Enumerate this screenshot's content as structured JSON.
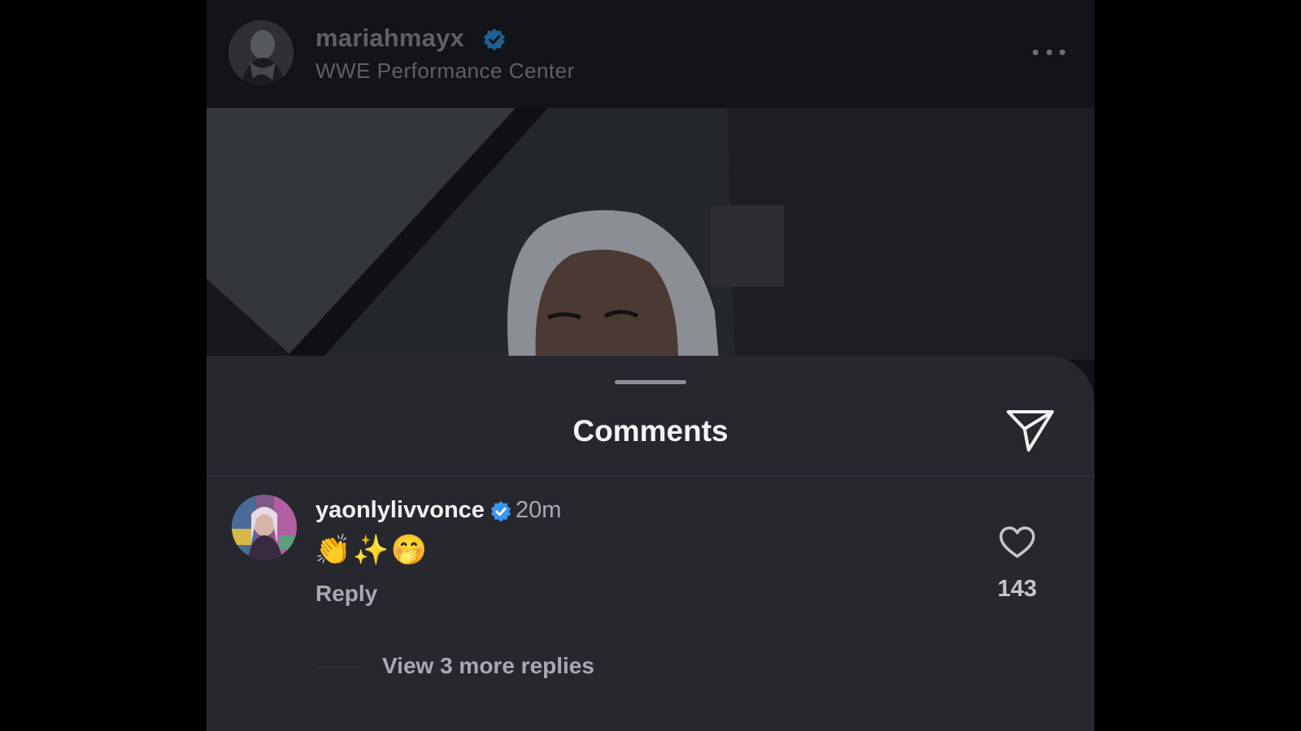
{
  "post": {
    "username": "mariahmayx",
    "location": "WWE Performance Center",
    "verified_icon": "verified-badge-icon",
    "more_icon": "more-horizontal-icon"
  },
  "comments_sheet": {
    "title": "Comments",
    "share_icon": "send-paper-plane-icon",
    "comment": {
      "username": "yaonlylivvonce",
      "time": "20m",
      "text": "👏✨🤭",
      "reply_label": "Reply",
      "like_count": "143",
      "like_icon": "heart-outline-icon"
    },
    "view_replies_label": "View 3 more replies"
  },
  "colors": {
    "sheet_bg": "#26282d",
    "verified_blue": "#3897f0",
    "text_primary": "#f1f1f2",
    "text_secondary": "#a7aab0"
  }
}
